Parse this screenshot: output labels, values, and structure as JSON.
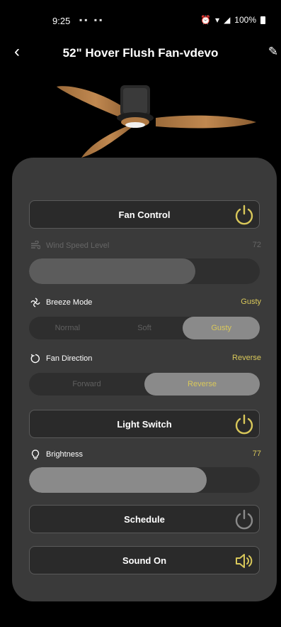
{
  "status_bar": {
    "time": "9:25",
    "battery": "100%"
  },
  "header": {
    "title": "52\" Hover Flush Fan-vdevo"
  },
  "fan_control": {
    "label": "Fan Control"
  },
  "wind_speed": {
    "label": "Wind Speed Level",
    "value": "72",
    "level_percent": 72
  },
  "breeze_mode": {
    "label": "Breeze Mode",
    "value": "Gusty",
    "options": [
      "Normal",
      "Soft",
      "Gusty"
    ],
    "selected": "Gusty"
  },
  "fan_direction": {
    "label": "Fan Direction",
    "value": "Reverse",
    "options": [
      "Forward",
      "Reverse"
    ],
    "selected": "Reverse"
  },
  "light_switch": {
    "label": "Light Switch"
  },
  "brightness": {
    "label": "Brightness",
    "value": "77",
    "level_percent": 77
  },
  "schedule": {
    "label": "Schedule"
  },
  "sound": {
    "label": "Sound On"
  },
  "colors": {
    "accent": "#d9c85a",
    "panel": "#3a3a3a",
    "background": "#000000"
  },
  "icons": [
    "back-arrow",
    "edit-pencil",
    "power",
    "wind",
    "breeze",
    "rotate",
    "lightbulb",
    "speaker"
  ]
}
